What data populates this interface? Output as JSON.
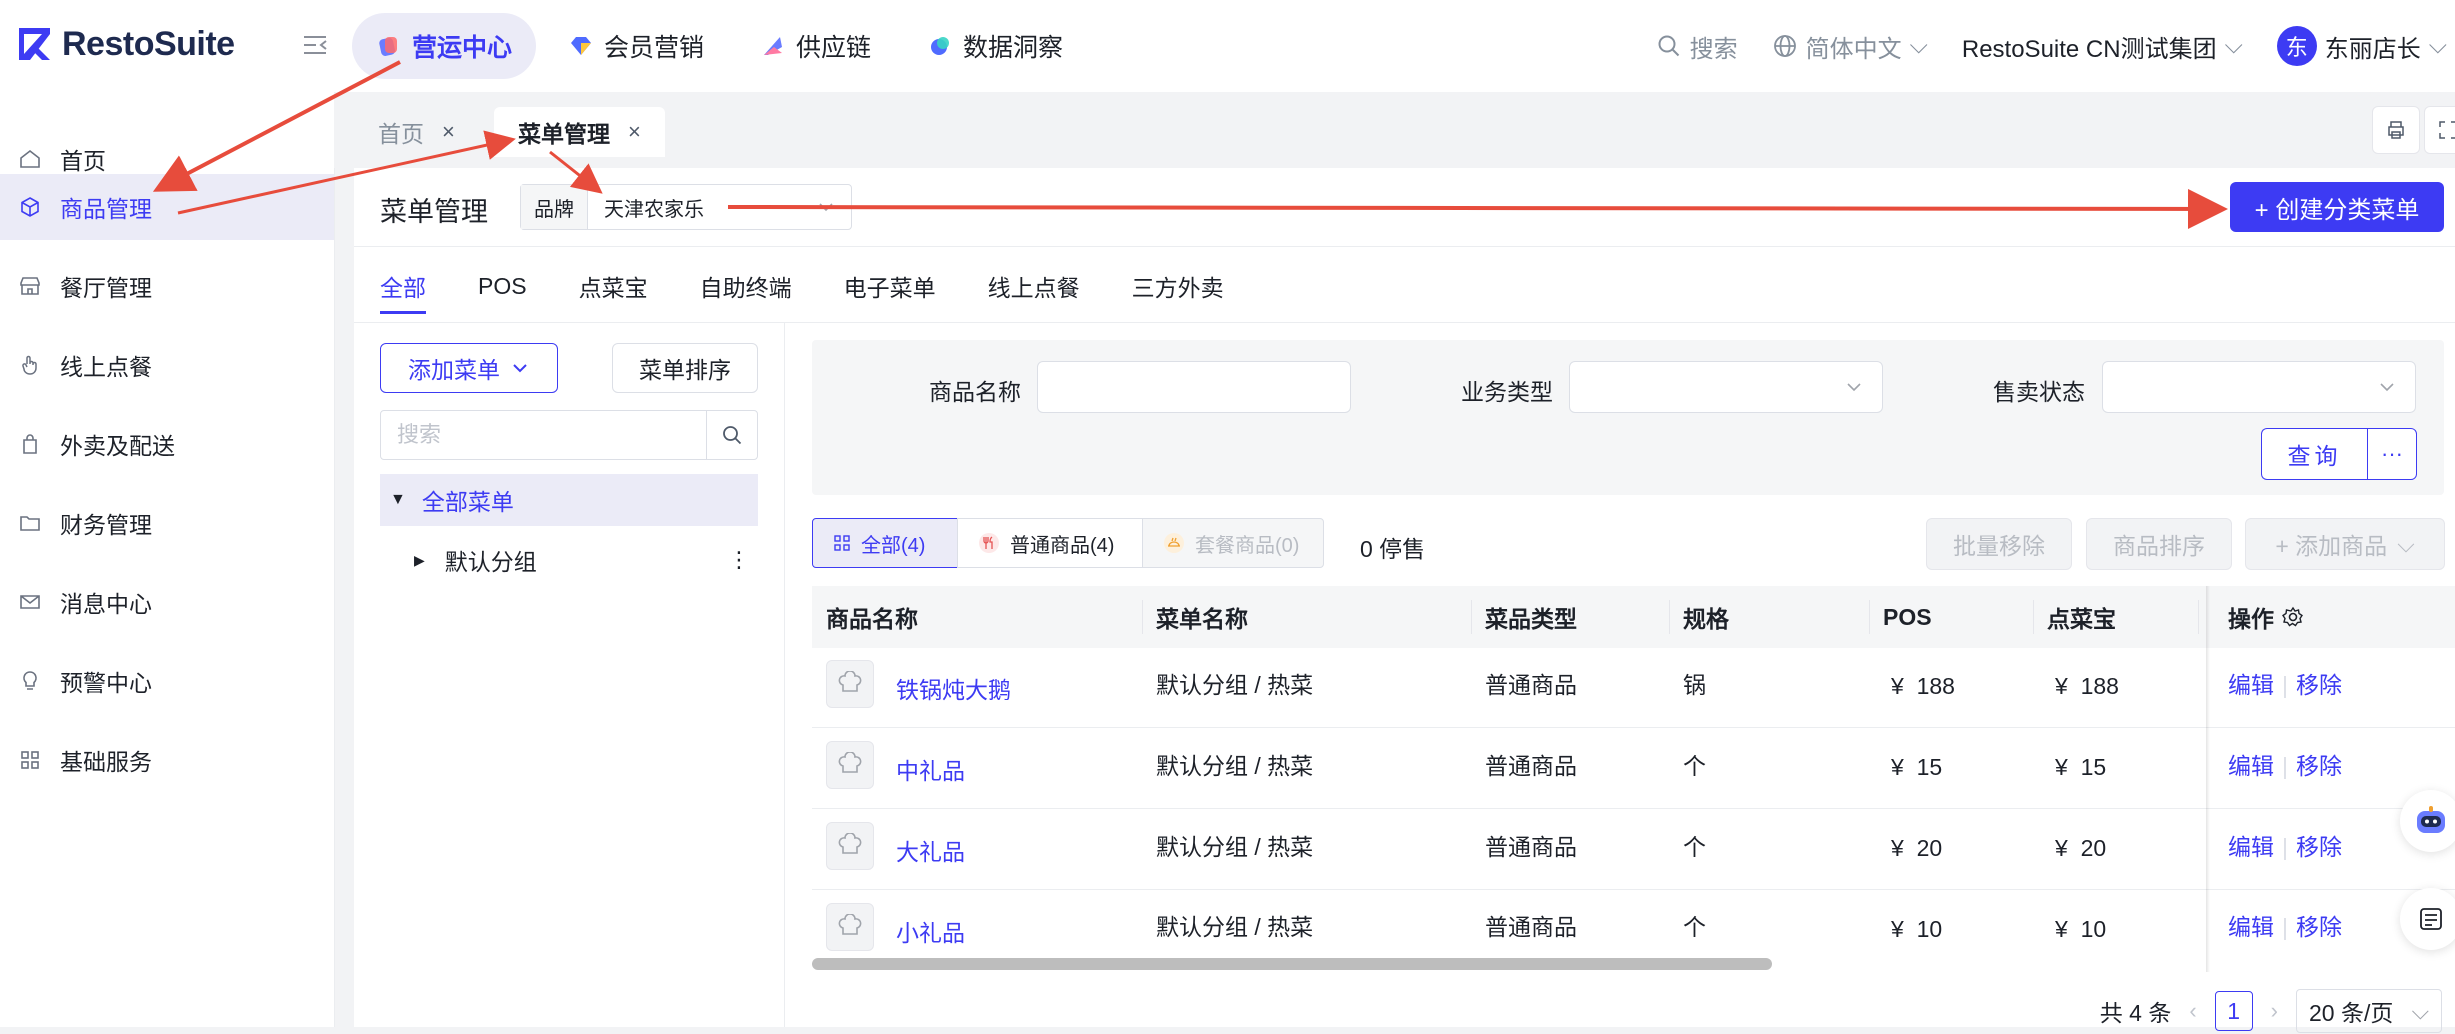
{
  "app": {
    "logo": "RestoSuite"
  },
  "topnav": [
    {
      "label": "营运中心",
      "active": true
    },
    {
      "label": "会员营销"
    },
    {
      "label": "供应链"
    },
    {
      "label": "数据洞察"
    }
  ],
  "topright": {
    "search": "搜索",
    "language": "简体中文",
    "org": "RestoSuite CN测试集团",
    "avatar": "东",
    "user": "东丽店长"
  },
  "sidebar": [
    {
      "label": "首页",
      "icon": "home-icon"
    },
    {
      "label": "商品管理",
      "icon": "box-icon",
      "active": true
    },
    {
      "label": "餐厅管理",
      "icon": "store-icon"
    },
    {
      "label": "线上点餐",
      "icon": "hand-icon"
    },
    {
      "label": "外卖及配送",
      "icon": "bag-icon"
    },
    {
      "label": "财务管理",
      "icon": "folder-icon"
    },
    {
      "label": "消息中心",
      "icon": "mail-icon"
    },
    {
      "label": "预警中心",
      "icon": "bulb-icon"
    },
    {
      "label": "基础服务",
      "icon": "grid-icon"
    }
  ],
  "page_tabs": [
    {
      "label": "首页",
      "close": "×"
    },
    {
      "label": "菜单管理",
      "close": "×",
      "active": true
    }
  ],
  "header": {
    "title": "菜单管理",
    "brand_label": "品牌",
    "brand_value": "天津农家乐",
    "create_button": "+ 创建分类菜单"
  },
  "channel_tabs": [
    "全部",
    "POS",
    "点菜宝",
    "自助终端",
    "电子菜单",
    "线上点餐",
    "三方外卖"
  ],
  "tree": {
    "add_menu": "添加菜单",
    "sort_menu": "菜单排序",
    "search_placeholder": "搜索",
    "root": "全部菜单",
    "child": "默认分组"
  },
  "filters": {
    "name_label": "商品名称",
    "name_value": "",
    "biz_type_label": "业务类型",
    "sale_status_label": "售卖状态",
    "query": "查询",
    "more": "···"
  },
  "type_tabs": [
    {
      "label": "全部(4)",
      "active": true
    },
    {
      "label": "普通商品(4)"
    },
    {
      "label": "套餐商品(0)",
      "disabled": true
    }
  ],
  "stop_count": "0 停售",
  "actions": {
    "batch_remove": "批量移除",
    "sort_items": "商品排序",
    "add_items": "+ 添加商品"
  },
  "table": {
    "columns": [
      "商品名称",
      "菜单名称",
      "菜品类型",
      "规格",
      "POS",
      "点菜宝",
      "操作"
    ],
    "rows": [
      {
        "name": "铁锅炖大鹅",
        "menu": "默认分组 / 热菜",
        "type": "普通商品",
        "spec": "锅",
        "pos": "¥  188",
        "dcb": "¥  188"
      },
      {
        "name": "中礼品",
        "menu": "默认分组 / 热菜",
        "type": "普通商品",
        "spec": "个",
        "pos": "¥  15",
        "dcb": "¥  15"
      },
      {
        "name": "大礼品",
        "menu": "默认分组 / 热菜",
        "type": "普通商品",
        "spec": "个",
        "pos": "¥  20",
        "dcb": "¥  20"
      },
      {
        "name": "小礼品",
        "menu": "默认分组 / 热菜",
        "type": "普通商品",
        "spec": "个",
        "pos": "¥  10",
        "dcb": "¥  10"
      }
    ],
    "edit": "编辑",
    "remove": "移除"
  },
  "pager": {
    "total": "共 4 条",
    "page": "1",
    "size": "20 条/页"
  },
  "colors": {
    "accent": "#3d3bf3",
    "annotation": "#e74c3c"
  }
}
